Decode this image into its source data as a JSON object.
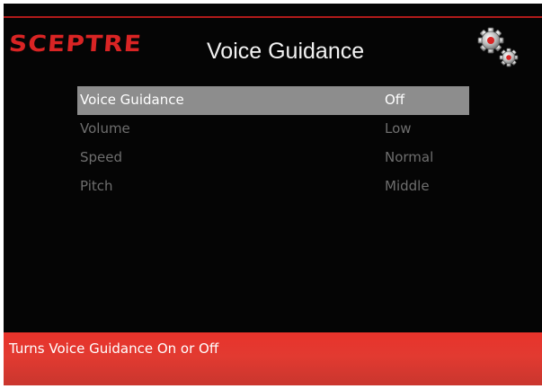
{
  "brand": {
    "logo_text": "SCEPTRE",
    "logo_color": "#d92424"
  },
  "header": {
    "title": "Voice Guidance",
    "icon": "gear-icon"
  },
  "menu": {
    "items": [
      {
        "label": "Voice Guidance",
        "value": "Off",
        "selected": true
      },
      {
        "label": "Volume",
        "value": "Low",
        "selected": false
      },
      {
        "label": "Speed",
        "value": "Normal",
        "selected": false
      },
      {
        "label": "Pitch",
        "value": "Middle",
        "selected": false
      }
    ],
    "highlight_color": "#8d8d8d"
  },
  "footer": {
    "help_text": "Turns Voice Guidance On or Off",
    "color": "#e23a31"
  }
}
